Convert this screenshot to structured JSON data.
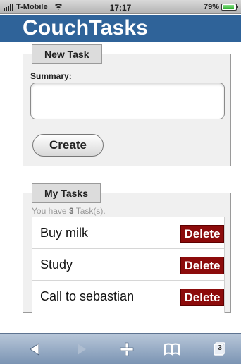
{
  "status_bar": {
    "carrier": "T-Mobile",
    "time": "17:17",
    "battery_text": "79%",
    "battery_level": 0.79
  },
  "header": {
    "title": "CouchTasks"
  },
  "new_task": {
    "legend": "New Task",
    "summary_label": "Summary:",
    "summary_value": "",
    "create_label": "Create"
  },
  "my_tasks": {
    "legend": "My Tasks",
    "count_prefix": "You have ",
    "count": "3",
    "count_suffix": " Task(s).",
    "delete_label": "Delete",
    "tasks": [
      {
        "name": "Buy milk"
      },
      {
        "name": "Study"
      },
      {
        "name": "Call to sebastian"
      }
    ]
  },
  "toolbar": {
    "icons": [
      "back-arrow",
      "forward-arrow",
      "plus",
      "bookmarks",
      "pages"
    ],
    "pages_count": "3"
  },
  "colors": {
    "header": "#2f6399",
    "delete": "#8c0b0b",
    "toolbar": "#7b94b3"
  }
}
